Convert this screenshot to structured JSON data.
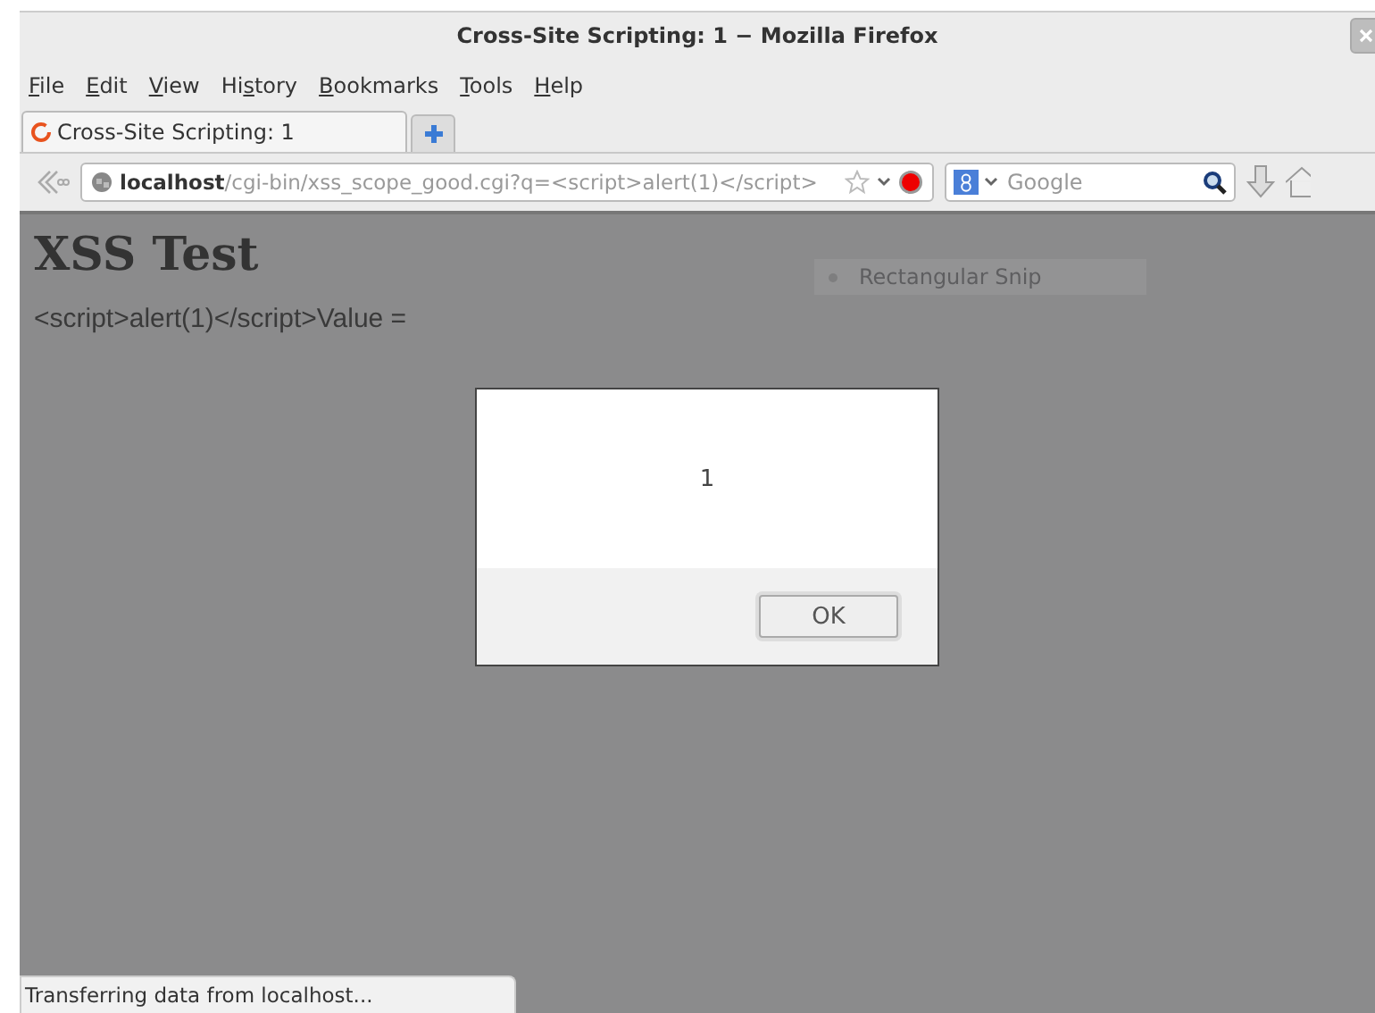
{
  "window": {
    "title": "Cross-Site Scripting: 1 − Mozilla Firefox"
  },
  "menu": [
    {
      "key": "F",
      "after": "ile"
    },
    {
      "key": "E",
      "after": "dit"
    },
    {
      "key": "V",
      "after": "iew"
    },
    {
      "before": "Hi",
      "key": "s",
      "after": "tory"
    },
    {
      "key": "B",
      "after": "ookmarks"
    },
    {
      "key": "T",
      "after": "ools"
    },
    {
      "key": "H",
      "after": "elp"
    }
  ],
  "tabs": [
    {
      "label": "Cross-Site Scripting: 1",
      "selected": true
    }
  ],
  "address": {
    "host": "localhost",
    "path": "/cgi-bin/xss_scope_good.cgi?q=<script>alert(1)</script>"
  },
  "search": {
    "placeholder": "Google"
  },
  "page": {
    "heading": "XSS Test",
    "text": "<script>alert(1)</script>Value =",
    "ghost_label": "Rectangular Snip"
  },
  "dialog": {
    "message": "1",
    "button": "OK"
  },
  "status_bar": "Transferring data from localhost..."
}
